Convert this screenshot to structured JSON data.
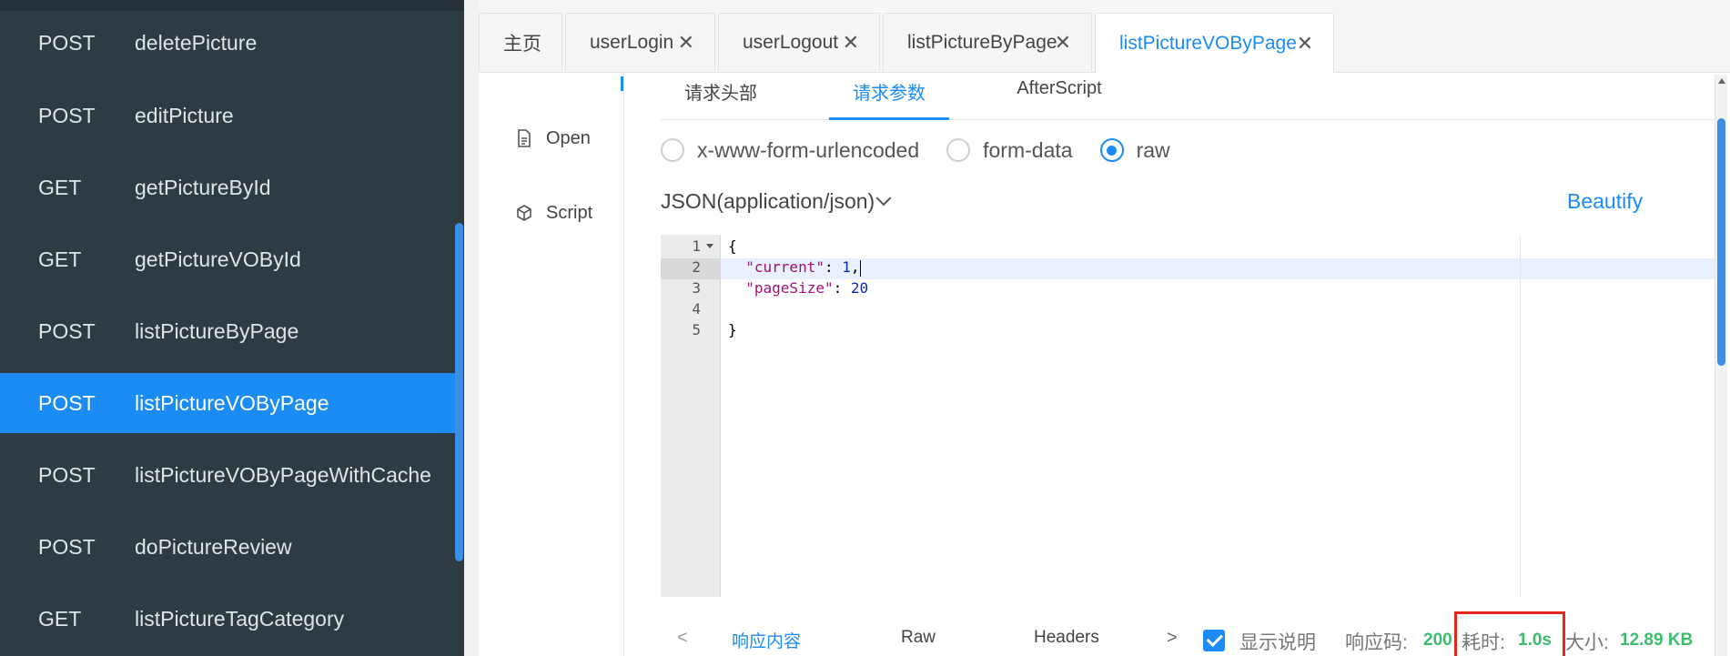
{
  "sidebar": {
    "items": [
      {
        "method": "POST",
        "name": "deletePicture",
        "active": false
      },
      {
        "method": "POST",
        "name": "editPicture",
        "active": false
      },
      {
        "method": "GET",
        "name": "getPictureById",
        "active": false
      },
      {
        "method": "GET",
        "name": "getPictureVOById",
        "active": false
      },
      {
        "method": "POST",
        "name": "listPictureByPage",
        "active": false
      },
      {
        "method": "POST",
        "name": "listPictureVOByPage",
        "active": true
      },
      {
        "method": "POST",
        "name": "listPictureVOByPageWithCache",
        "active": false
      },
      {
        "method": "POST",
        "name": "doPictureReview",
        "active": false
      },
      {
        "method": "GET",
        "name": "listPictureTagCategory",
        "active": false
      }
    ]
  },
  "tabs": [
    {
      "label": "主页",
      "closable": false,
      "active": false
    },
    {
      "label": "userLogin",
      "closable": true,
      "active": false
    },
    {
      "label": "userLogout",
      "closable": true,
      "active": false
    },
    {
      "label": "listPictureByPage",
      "closable": true,
      "active": false
    },
    {
      "label": "listPictureVOByPage",
      "closable": true,
      "active": true
    }
  ],
  "vnav": {
    "open_label": "Open",
    "script_label": "Script"
  },
  "subtabs": {
    "headers": "请求头部",
    "params": "请求参数",
    "afterscript": "AfterScript"
  },
  "body_type": {
    "urlencoded": "x-www-form-urlencoded",
    "formdata": "form-data",
    "raw": "raw",
    "selected": "raw"
  },
  "content_type": "JSON(application/json)",
  "beautify_label": "Beautify",
  "editor": {
    "line_numbers": [
      "1",
      "2",
      "3",
      "4",
      "5"
    ],
    "lines": {
      "l1": "{",
      "l2_key": "\"current\"",
      "l2_sep": ": ",
      "l2_val": "1",
      "l2_end": ",",
      "l3_key": "\"pageSize\"",
      "l3_sep": ": ",
      "l3_val": "20",
      "l5": "}"
    }
  },
  "response": {
    "tab_content": "响应内容",
    "tab_raw": "Raw",
    "tab_headers": "Headers",
    "prev": "<",
    "next": ">",
    "show_desc_label": "显示说明",
    "status_label": "响应码:",
    "status_value": "200",
    "time_label": "耗时:",
    "time_value": "1.0s",
    "size_label": "大小:",
    "size_value": "12.89 KB"
  },
  "colors": {
    "accent": "#1c8cf5",
    "sidebar_bg": "#2f3b43",
    "success": "#3cbd6e",
    "highlight": "#e5261f"
  }
}
